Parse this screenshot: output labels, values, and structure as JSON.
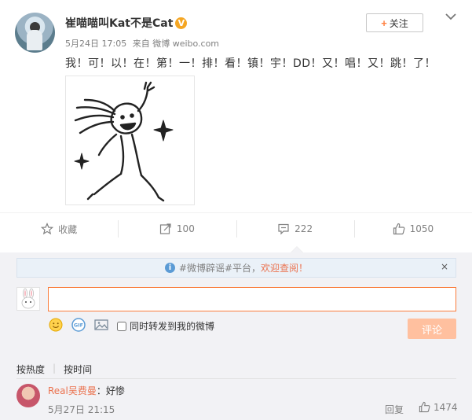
{
  "post": {
    "username": "崔喵喵叫Kat不是Cat",
    "verified_badge": "V",
    "date": "5月24日 17:05",
    "source": "来自 微博 weibo.com",
    "follow_label": "关注",
    "follow_plus": "+",
    "text": "我！可！以！在！第！一！排！看！镇！宇！DD！又！唱！又！跳！了！",
    "image_alt": "meme-drawing"
  },
  "actions": {
    "favorite_label": "收藏",
    "repost_count": "100",
    "comment_count": "222",
    "like_count": "1050"
  },
  "comment_box": {
    "notice_prefix": "#微博辟谣#平台，",
    "notice_highlight": "欢迎查阅！",
    "notice_close": "×",
    "input_value": "",
    "repost_checkbox_label": "同时转发到我的微博",
    "submit_label": "评论"
  },
  "sort": {
    "by_hot": "按热度",
    "by_time": "按时间",
    "separator": "|"
  },
  "comments": [
    {
      "user": "Real吴费曼",
      "text": "：好惨",
      "time": "5月27日 21:15",
      "reply_label": "回复",
      "likes": "1474"
    }
  ],
  "colors": {
    "accent": "#eb7350",
    "input_border": "#fa7d3c",
    "submit_disabled": "#ffc09f",
    "vip_badge": "#f5a623",
    "comment_bg": "#f2f2f5"
  }
}
